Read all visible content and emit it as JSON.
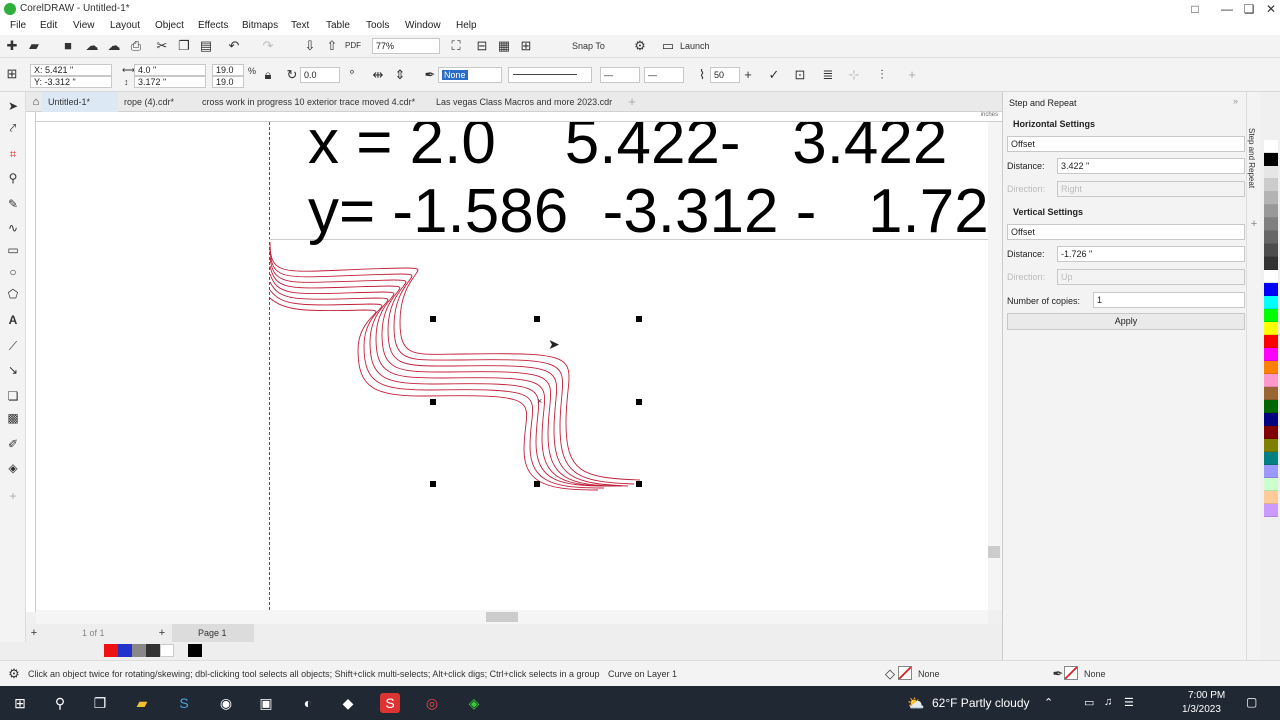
{
  "window": {
    "title": "CorelDRAW - Untitled-1*",
    "controls": [
      "□",
      "—",
      "❏",
      "✕"
    ]
  },
  "menu": [
    "File",
    "Edit",
    "View",
    "Layout",
    "Object",
    "Effects",
    "Bitmaps",
    "Text",
    "Table",
    "Tools",
    "Window",
    "Help"
  ],
  "toolbar": {
    "zoom": "77%",
    "snap_to": "Snap To",
    "launch": "Launch"
  },
  "property_bar": {
    "x": "X: 5.421 \"",
    "y": "Y: -3.312 \"",
    "width": "4.0 \"",
    "height": "3.172 \"",
    "scale_w": "19.0",
    "scale_h": "19.0",
    "percent": "%",
    "rotation": "0.0",
    "outline_fill": "None",
    "width_value": "50"
  },
  "doc_tabs": [
    "Untitled-1*",
    "rope (4).cdr*",
    "cross work in progress 10 exterior trace moved 4.cdr*",
    "Las vegas Class Macros and more 2023.cdr"
  ],
  "canvas": {
    "line1": "x = 2.0    5.422-   3.422",
    "line2": "y= -1.586  -3.312 -   1.72",
    "ruler_unit": "inches"
  },
  "page_nav": {
    "page_count": "1  of  1",
    "page_tab": "Page 1"
  },
  "docker": {
    "title": "Step and Repeat",
    "tab_label": "Step and Repeat",
    "horizontal": {
      "heading": "Horizontal Settings",
      "mode": "Offset",
      "distance_label": "Distance:",
      "distance": "3.422 \"",
      "direction_label": "Direction:",
      "direction": "Right"
    },
    "vertical": {
      "heading": "Vertical Settings",
      "mode": "Offset",
      "distance_label": "Distance:",
      "distance": "-1.726 \"",
      "direction_label": "Direction:",
      "direction": "Up"
    },
    "copies_label": "Number of copies:",
    "copies": "1",
    "apply": "Apply"
  },
  "status": {
    "hint": "Click an object twice for rotating/skewing; dbl-clicking tool selects all objects; Shift+click multi-selects; Alt+click digs; Ctrl+click selects in a group",
    "object": "Curve on Layer 1",
    "fill": "None",
    "outline": "None"
  },
  "taskbar": {
    "weather": "62°F  Partly cloudy",
    "time": "7:00 PM",
    "date": "1/3/2023"
  },
  "colors": {
    "curve_stroke": "#c0203a",
    "palette": [
      "#ffffff",
      "#000000",
      "#e6e6e6",
      "#cccccc",
      "#b3b3b3",
      "#999999",
      "#808080",
      "#666666",
      "#4d4d4d",
      "#333333",
      "#ffffff",
      "#0000ff",
      "#00ffff",
      "#00ff00",
      "#ffff00",
      "#ff0000",
      "#ff00ff",
      "#ff8000",
      "#ff99cc",
      "#996633",
      "#006600",
      "#000080",
      "#800000",
      "#808000",
      "#008080",
      "#9999ff",
      "#ccffcc",
      "#ffcc99",
      "#cc99ff"
    ]
  }
}
